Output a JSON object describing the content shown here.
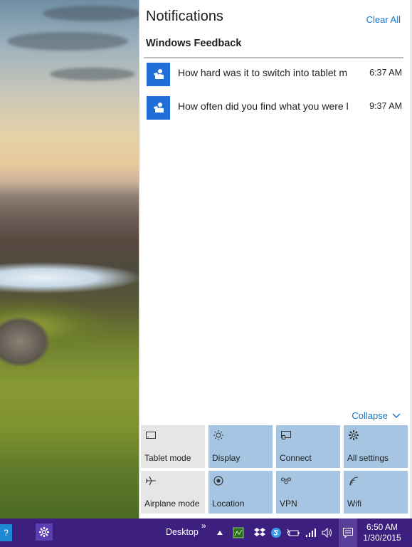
{
  "action_center": {
    "title": "Notifications",
    "clear_all": "Clear All",
    "group": "Windows Feedback",
    "notifications": [
      {
        "icon": "windows-feedback-icon",
        "text": "How hard was it to switch into tablet m",
        "time": "6:37 AM"
      },
      {
        "icon": "windows-feedback-icon",
        "text": "How often did you find what you were l",
        "time": "9:37 AM"
      }
    ],
    "collapse": "Collapse",
    "quick_actions": [
      {
        "label": "Tablet mode",
        "icon": "tablet-mode-icon",
        "active": false
      },
      {
        "label": "Display",
        "icon": "brightness-icon",
        "active": true
      },
      {
        "label": "Connect",
        "icon": "connect-icon",
        "active": true
      },
      {
        "label": "All settings",
        "icon": "gear-icon",
        "active": true
      },
      {
        "label": "Airplane mode",
        "icon": "airplane-icon",
        "active": false
      },
      {
        "label": "Location",
        "icon": "location-icon",
        "active": true
      },
      {
        "label": "VPN",
        "icon": "vpn-icon",
        "active": true
      },
      {
        "label": "Wifi",
        "icon": "wifi-icon",
        "active": true
      }
    ],
    "colors": {
      "accent": "#1a73c9",
      "tile_on": "#a6c5e3",
      "tile_off": "#e6e6e6",
      "app_icon": "#1f6fd6"
    }
  },
  "taskbar": {
    "desktop_label": "Desktop",
    "chevron": "»",
    "time": "6:50 AM",
    "date": "1/30/2015",
    "color": "#3c1f7e"
  }
}
